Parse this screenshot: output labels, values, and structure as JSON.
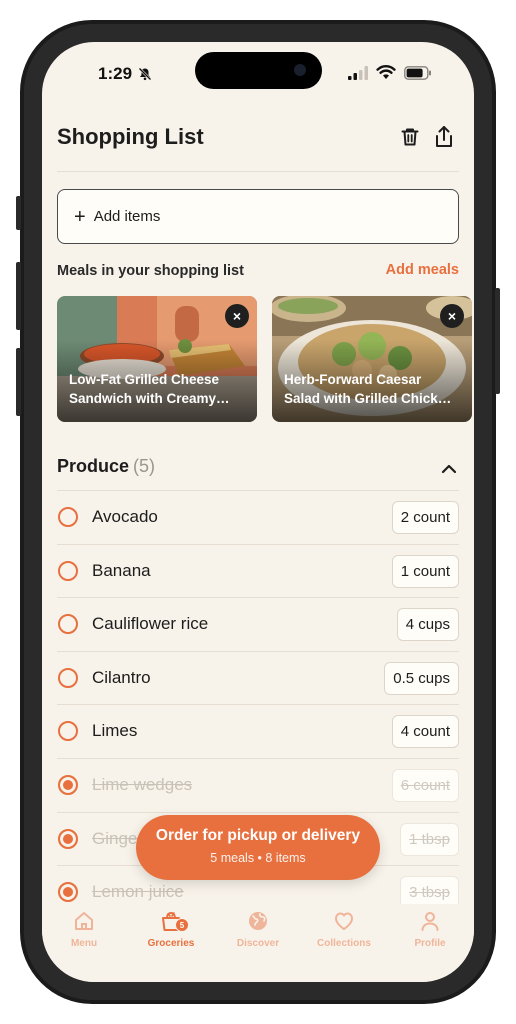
{
  "status_bar": {
    "time": "1:29"
  },
  "header": {
    "title": "Shopping List"
  },
  "add_items": {
    "label": "Add items"
  },
  "meals": {
    "section_label": "Meals in your shopping list",
    "add_meals_label": "Add meals",
    "cards": [
      {
        "name": "Low-Fat Grilled Cheese\nSandwich with Creamy…"
      },
      {
        "name": "Herb-Forward Caesar\nSalad with Grilled Chick…"
      }
    ]
  },
  "produce": {
    "title": "Produce",
    "count": "(5)",
    "items": [
      {
        "name": "Avocado",
        "qty": "2 count",
        "checked": false
      },
      {
        "name": "Banana",
        "qty": "1 count",
        "checked": false
      },
      {
        "name": "Cauliflower rice",
        "qty": "4 cups",
        "checked": false
      },
      {
        "name": "Cilantro",
        "qty": "0.5 cups",
        "checked": false
      },
      {
        "name": "Limes",
        "qty": "4 count",
        "checked": false
      },
      {
        "name": "Lime wedges",
        "qty": "6 count",
        "checked": true
      },
      {
        "name": "Ginger",
        "qty": "1 tbsp",
        "checked": true
      },
      {
        "name": "Lemon juice",
        "qty": "3 tbsp",
        "checked": true
      }
    ]
  },
  "order": {
    "title": "Order for pickup or delivery",
    "subtitle": "5 meals • 8 items"
  },
  "tabs": [
    {
      "label": "Menu",
      "icon": "home-icon"
    },
    {
      "label": "Groceries",
      "icon": "grocery-bag-icon",
      "badge": "5"
    },
    {
      "label": "Discover",
      "icon": "globe-icon"
    },
    {
      "label": "Collections",
      "icon": "heart-icon"
    },
    {
      "label": "Profile",
      "icon": "person-icon"
    }
  ],
  "colors": {
    "accent": "#e8703f",
    "background": "#f8f3ea",
    "text": "#1d1d1d"
  }
}
